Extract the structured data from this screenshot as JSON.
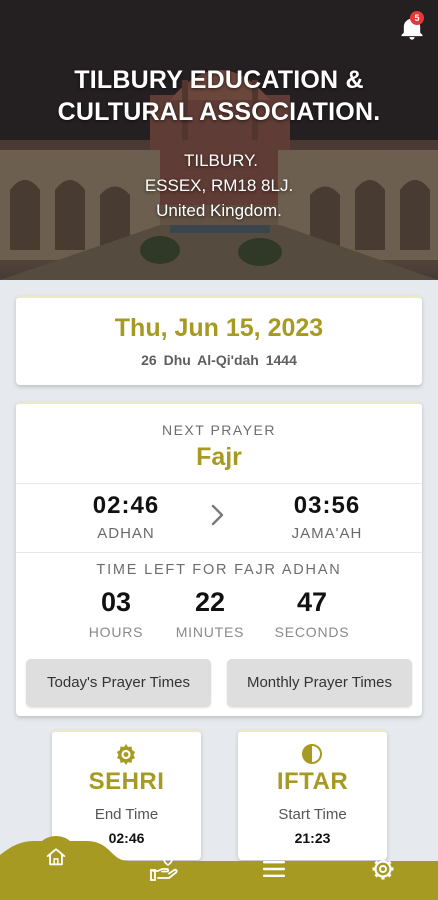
{
  "header": {
    "org_name_line1": "TILBURY EDUCATION &",
    "org_name_line2": "CULTURAL ASSOCIATION.",
    "address_line1": "TILBURY.",
    "address_line2": "ESSEX, RM18 8LJ.",
    "address_line3": "United Kingdom.",
    "notification_icon": "bell-icon",
    "notification_count": "5"
  },
  "date": {
    "gregorian": "Thu, Jun 15, 2023",
    "hijri": "26  Dhu Al-Qi'dah  1444"
  },
  "next_prayer": {
    "label": "NEXT PRAYER",
    "name": "Fajr",
    "adhan_time": "02:46",
    "adhan_label": "ADHAN",
    "jamaah_time": "03:56",
    "jamaah_label": "JAMA'AH",
    "time_left_label": "TIME LEFT FOR FAJR ADHAN",
    "hours": "03",
    "hours_label": "HOURS",
    "minutes": "22",
    "minutes_label": "MINUTES",
    "seconds": "47",
    "seconds_label": "SECONDS",
    "today_button": "Today's Prayer Times",
    "monthly_button": "Monthly Prayer Times"
  },
  "sehri": {
    "title": "SEHRI",
    "subtitle": "End Time",
    "time": "02:46",
    "icon": "sun-gear-icon"
  },
  "iftar": {
    "title": "IFTAR",
    "subtitle": "Start Time",
    "time": "21:23",
    "icon": "half-moon-icon"
  },
  "nav": {
    "items": [
      "home-icon",
      "donate-hand-icon",
      "menu-icon",
      "settings-gear-icon"
    ]
  },
  "colors": {
    "accent": "#a79a22",
    "background": "#e6eaee",
    "badge": "#e53935"
  }
}
